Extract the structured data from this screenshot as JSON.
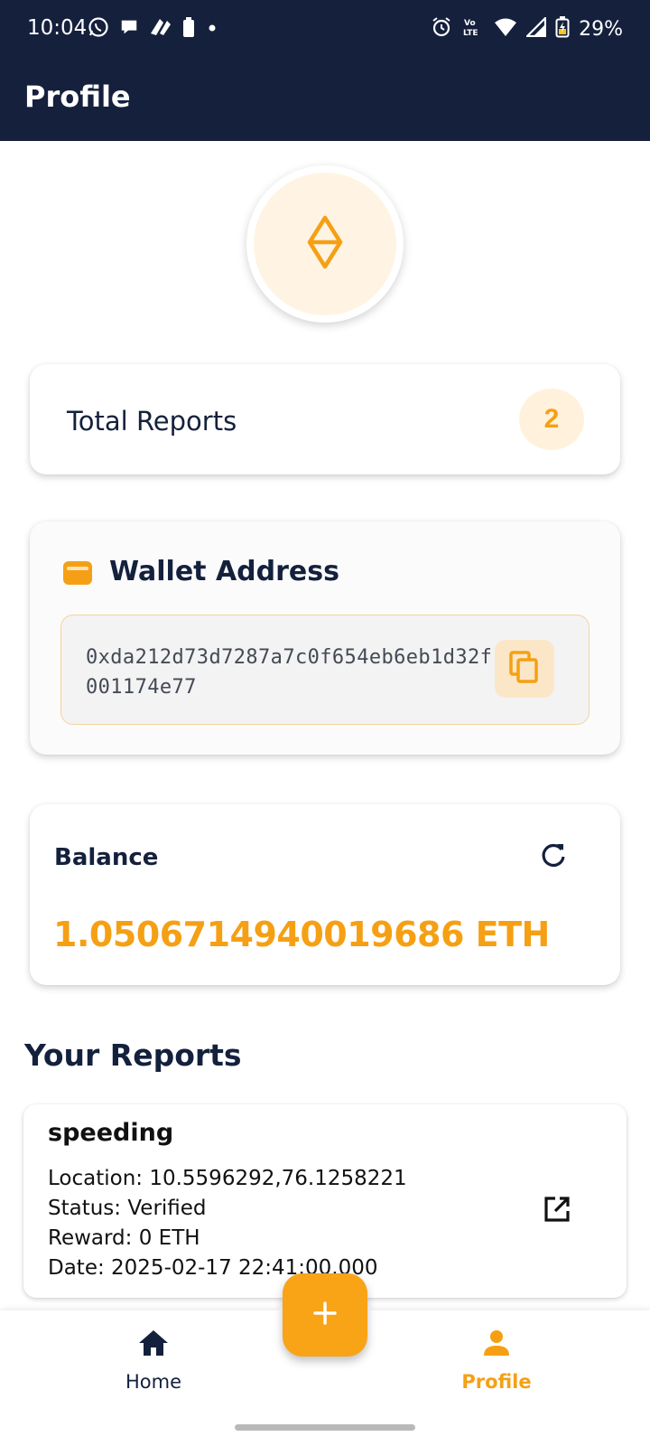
{
  "status_bar": {
    "time": "10:04",
    "battery": "29%",
    "left_icons": [
      "whatsapp-icon",
      "chat-icon",
      "app-icon",
      "battery-small-icon",
      "dot-icon"
    ],
    "right_icons": [
      "alarm-icon",
      "volte-icon",
      "wifi-icon",
      "signal-icon",
      "battery-icon"
    ]
  },
  "app_bar": {
    "title": "Profile"
  },
  "avatar": {
    "icon": "ethereum-icon"
  },
  "total_reports": {
    "label": "Total Reports",
    "count": "2"
  },
  "wallet": {
    "title": "Wallet Address",
    "address": "0xda212d73d7287a7c0f654eb6eb1d32f001174e77"
  },
  "balance": {
    "label": "Balance",
    "value": "1.0506714940019686 ETH"
  },
  "reports_section": {
    "title": "Your Reports"
  },
  "reports": [
    {
      "title": "speeding",
      "location": "Location: 10.5596292,76.1258221",
      "status": "Status: Verified",
      "reward": "Reward: 0 ETH",
      "date": "Date: 2025-02-17 22:41:00.000"
    }
  ],
  "bottom_nav": {
    "home_label": "Home",
    "profile_label": "Profile",
    "fab_icon": "plus-icon"
  },
  "colors": {
    "header": "#15203d",
    "accent": "#f5a014",
    "text_dark": "#14213d"
  }
}
